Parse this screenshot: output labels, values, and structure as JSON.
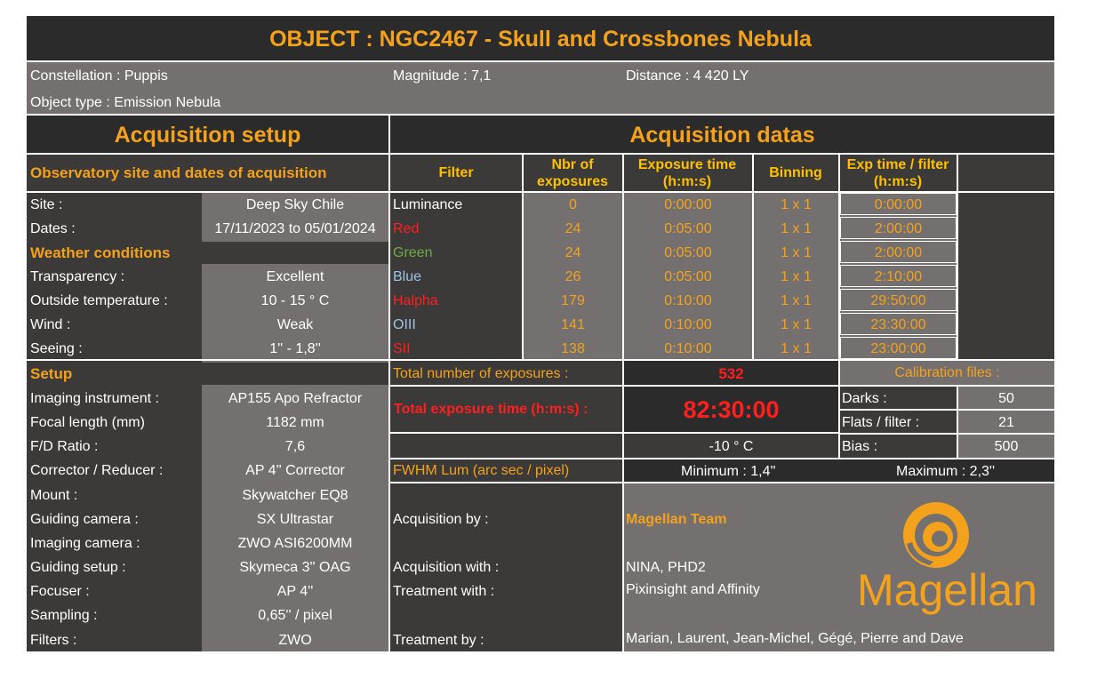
{
  "title": "OBJECT : NGC2467 - Skull and Crossbones Nebula",
  "info": {
    "constellation": "Constellation : Puppis",
    "magnitude": "Magnitude : 7,1",
    "distance": "Distance : 4 420 LY",
    "object_type": "Object type :  Emission Nebula"
  },
  "left": {
    "header": "Acquisition setup",
    "site_header": "Observatory site and dates of acquisition",
    "site_rows": [
      {
        "label": "Site :",
        "value": "Deep Sky Chile"
      },
      {
        "label": "Dates :",
        "value": "17/11/2023 to 05/01/2024"
      }
    ],
    "weather_header": "Weather conditions",
    "weather_rows": [
      {
        "label": "Transparency :",
        "value": "Excellent"
      },
      {
        "label": "Outside temperature :",
        "value": "10 - 15 ° C"
      },
      {
        "label": "Wind :",
        "value": "Weak"
      },
      {
        "label": "Seeing :",
        "value": "1'' - 1,8''"
      }
    ],
    "setup_header": "Setup",
    "setup_rows": [
      {
        "label": "Imaging instrument :",
        "value": "AP155 Apo Refractor"
      },
      {
        "label": "Focal length (mm)",
        "value": "1182 mm"
      },
      {
        "label": "F/D Ratio :",
        "value": "7,6"
      },
      {
        "label": "Corrector / Reducer :",
        "value": "AP 4'' Corrector"
      },
      {
        "label": "Mount :",
        "value": "Skywatcher EQ8"
      },
      {
        "label": "Guiding camera :",
        "value": "SX Ultrastar"
      },
      {
        "label": "Imaging camera :",
        "value": "ZWO ASI6200MM"
      },
      {
        "label": "Guiding setup :",
        "value": "Skymeca 3'' OAG"
      },
      {
        "label": "Focuser :",
        "value": "AP 4''"
      },
      {
        "label": "Sampling :",
        "value": "0,65'' / pixel"
      },
      {
        "label": "Filters :",
        "value": "ZWO"
      }
    ]
  },
  "right": {
    "header": "Acquisition datas",
    "columns": {
      "filter": "Filter",
      "nbr": "Nbr of exposures",
      "exp": "Exposure time (h:m:s)",
      "binning": "Binning",
      "exp_filter": "Exp time / filter (h:m:s)"
    },
    "rows": [
      {
        "filter": "Luminance",
        "color": "#ffffff",
        "nbr": "0",
        "exp": "0:00:00",
        "bin": "1 x 1",
        "total": "0:00:00"
      },
      {
        "filter": "Red",
        "color": "#ff1f1f",
        "nbr": "24",
        "exp": "0:05:00",
        "bin": "1 x 1",
        "total": "2:00:00"
      },
      {
        "filter": "Green",
        "color": "#70ad47",
        "nbr": "24",
        "exp": "0:05:00",
        "bin": "1 x 1",
        "total": "2:00:00"
      },
      {
        "filter": "Blue",
        "color": "#9dc3e6",
        "nbr": "26",
        "exp": "0:05:00",
        "bin": "1 x 1",
        "total": "2:10:00"
      },
      {
        "filter": "Halpha",
        "color": "#ff1f1f",
        "nbr": "179",
        "exp": "0:10:00",
        "bin": "1 x 1",
        "total": "29:50:00"
      },
      {
        "filter": "OIII",
        "color": "#9dc3e6",
        "nbr": "141",
        "exp": "0:10:00",
        "bin": "1 x 1",
        "total": "23:30:00"
      },
      {
        "filter": "SII",
        "color": "#ff1f1f",
        "nbr": "138",
        "exp": "0:10:00",
        "bin": "1 x 1",
        "total": "23:00:00"
      }
    ],
    "total_exposures_label": "Total number of exposures :",
    "total_exposures_value": "532",
    "total_time_label": "Total exposure time (h:m:s) :",
    "total_time_value": "82:30:00",
    "temperature": "-10 ° C",
    "calibration": {
      "header": "Calibration files :",
      "rows": [
        {
          "label": "Darks :",
          "value": "50"
        },
        {
          "label": "Flats / filter :",
          "value": "21"
        },
        {
          "label": "Bias :",
          "value": "500"
        }
      ]
    },
    "fwhm_label": "FWHM Lum (arc sec / pixel)",
    "fwhm_min": "Minimum : 1,4''",
    "fwhm_max": "Maximum : 2,3''",
    "credits": {
      "acq_by_label": "Acquisition by :",
      "acq_by_value": "Magellan Team",
      "acq_with_label": "Acquisition with :",
      "acq_with_value": "NINA, PHD2",
      "treat_with_label": "Treatment with :",
      "treat_with_value": "Pixinsight and Affinity",
      "treat_by_label": "Treatment by :",
      "treat_by_value": "Marian, Laurent, Jean-Michel, Gégé, Pierre and Dave"
    },
    "logo_text": "Magellan"
  },
  "colors": {
    "accent": "#f4a21c",
    "header_yellow": "#ffc000",
    "dark_cell": "#3b3a39",
    "gray_cell": "#747070",
    "red_value": "#ff1f1f"
  }
}
